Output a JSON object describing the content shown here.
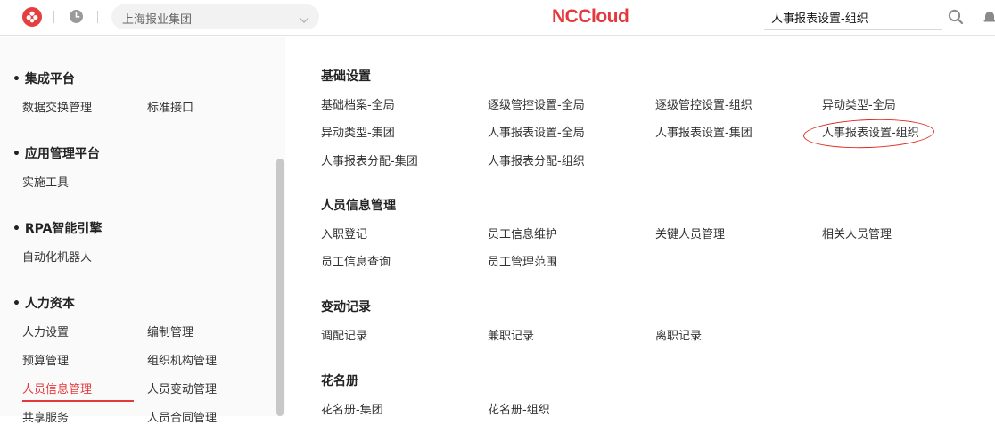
{
  "header": {
    "org_selector": "上海报业集团",
    "brand": "NCCloud",
    "search_value": "人事报表设置-组织",
    "icons": {
      "logo": "app-logo-icon",
      "clock": "clock-icon",
      "chevron": "chevron-down-icon",
      "search": "search-icon",
      "bell": "bell-icon"
    },
    "accent_color": "#e4393c"
  },
  "sidebar": {
    "groups": [
      {
        "title": "集成平台",
        "items": [
          "数据交换管理",
          "标准接口"
        ]
      },
      {
        "title": "应用管理平台",
        "items": [
          "实施工具"
        ]
      },
      {
        "title": "RPA智能引擎",
        "items": [
          "自动化机器人"
        ]
      },
      {
        "title": "人力资本",
        "items": [
          "人力设置",
          "编制管理",
          "预算管理",
          "组织机构管理",
          "人员信息管理",
          "人员变动管理",
          "共享服务",
          "人员合同管理"
        ]
      }
    ],
    "active_item": "人员信息管理"
  },
  "main": {
    "sections": [
      {
        "title": "基础设置",
        "links": [
          "基础档案-全局",
          "逐级管控设置-全局",
          "逐级管控设置-组织",
          "异动类型-全局",
          "异动类型-集团",
          "人事报表设置-全局",
          "人事报表设置-集团",
          "人事报表设置-组织",
          "人事报表分配-集团",
          "人事报表分配-组织"
        ]
      },
      {
        "title": "人员信息管理",
        "links": [
          "入职登记",
          "员工信息维护",
          "关键人员管理",
          "相关人员管理",
          "员工信息查询",
          "员工管理范围"
        ]
      },
      {
        "title": "变动记录",
        "links": [
          "调配记录",
          "兼职记录",
          "离职记录"
        ]
      },
      {
        "title": "花名册",
        "links": [
          "花名册-集团",
          "花名册-组织"
        ]
      }
    ],
    "highlighted_link": "人事报表设置-组织"
  }
}
